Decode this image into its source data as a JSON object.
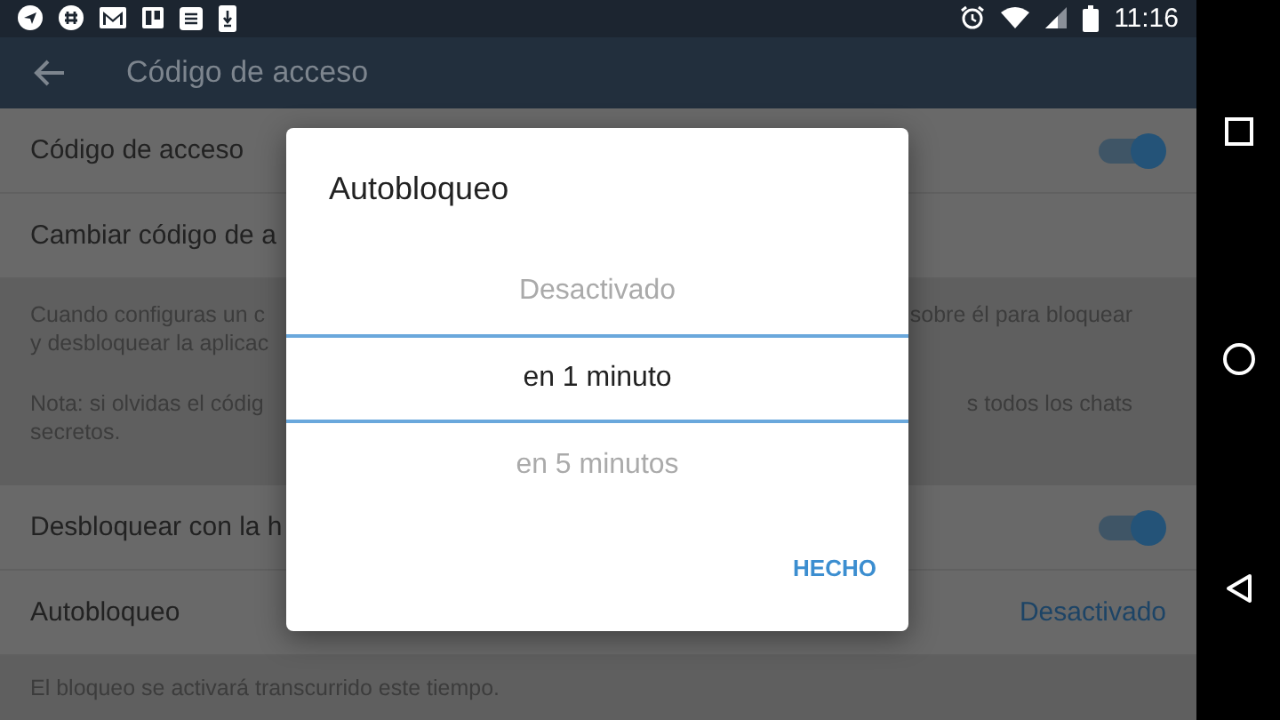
{
  "status_bar": {
    "time": "11:16"
  },
  "app_bar": {
    "title": "Código de acceso"
  },
  "rows": [
    {
      "kind": "toggle",
      "label": "Código de acceso",
      "on": true
    },
    {
      "kind": "link",
      "label": "Cambiar código de a"
    },
    {
      "kind": "info",
      "left_lines": [
        "Cuando configuras un c",
        "y desbloquear la aplicac"
      ],
      "right_lines": [
        "sobre él para bloquear"
      ]
    },
    {
      "kind": "info",
      "left_lines": [
        "Nota: si olvidas el códig",
        "secretos."
      ],
      "right_lines": [
        "s todos los chats"
      ]
    },
    {
      "kind": "toggle",
      "label": "Desbloquear con la h",
      "on": true
    },
    {
      "kind": "value",
      "label": "Autobloqueo",
      "value": "Desactivado"
    },
    {
      "kind": "footer",
      "label": "El bloqueo se activará transcurrido este tiempo."
    }
  ],
  "dialog": {
    "title": "Autobloqueo",
    "options": [
      {
        "label": "Desactivado",
        "selected": false
      },
      {
        "label": "en 1 minuto",
        "selected": true
      },
      {
        "label": "en 5 minutos",
        "selected": false
      }
    ],
    "button": "HECHO"
  }
}
